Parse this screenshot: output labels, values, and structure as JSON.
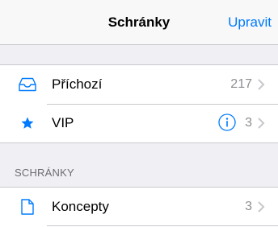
{
  "header": {
    "title": "Schránky",
    "edit_label": "Upravit"
  },
  "mailboxes": [
    {
      "label": "Příchozí",
      "count": "217",
      "icon": "inbox-tray-icon"
    },
    {
      "label": "VIP",
      "count": "3",
      "icon": "star-icon",
      "has_info": true
    }
  ],
  "section": {
    "header": "SCHRÁNKY",
    "items": [
      {
        "label": "Koncepty",
        "count": "3",
        "icon": "document-icon"
      }
    ]
  },
  "colors": {
    "accent": "#007aff",
    "secondary_text": "#8e8e93",
    "background": "#efeff4"
  }
}
